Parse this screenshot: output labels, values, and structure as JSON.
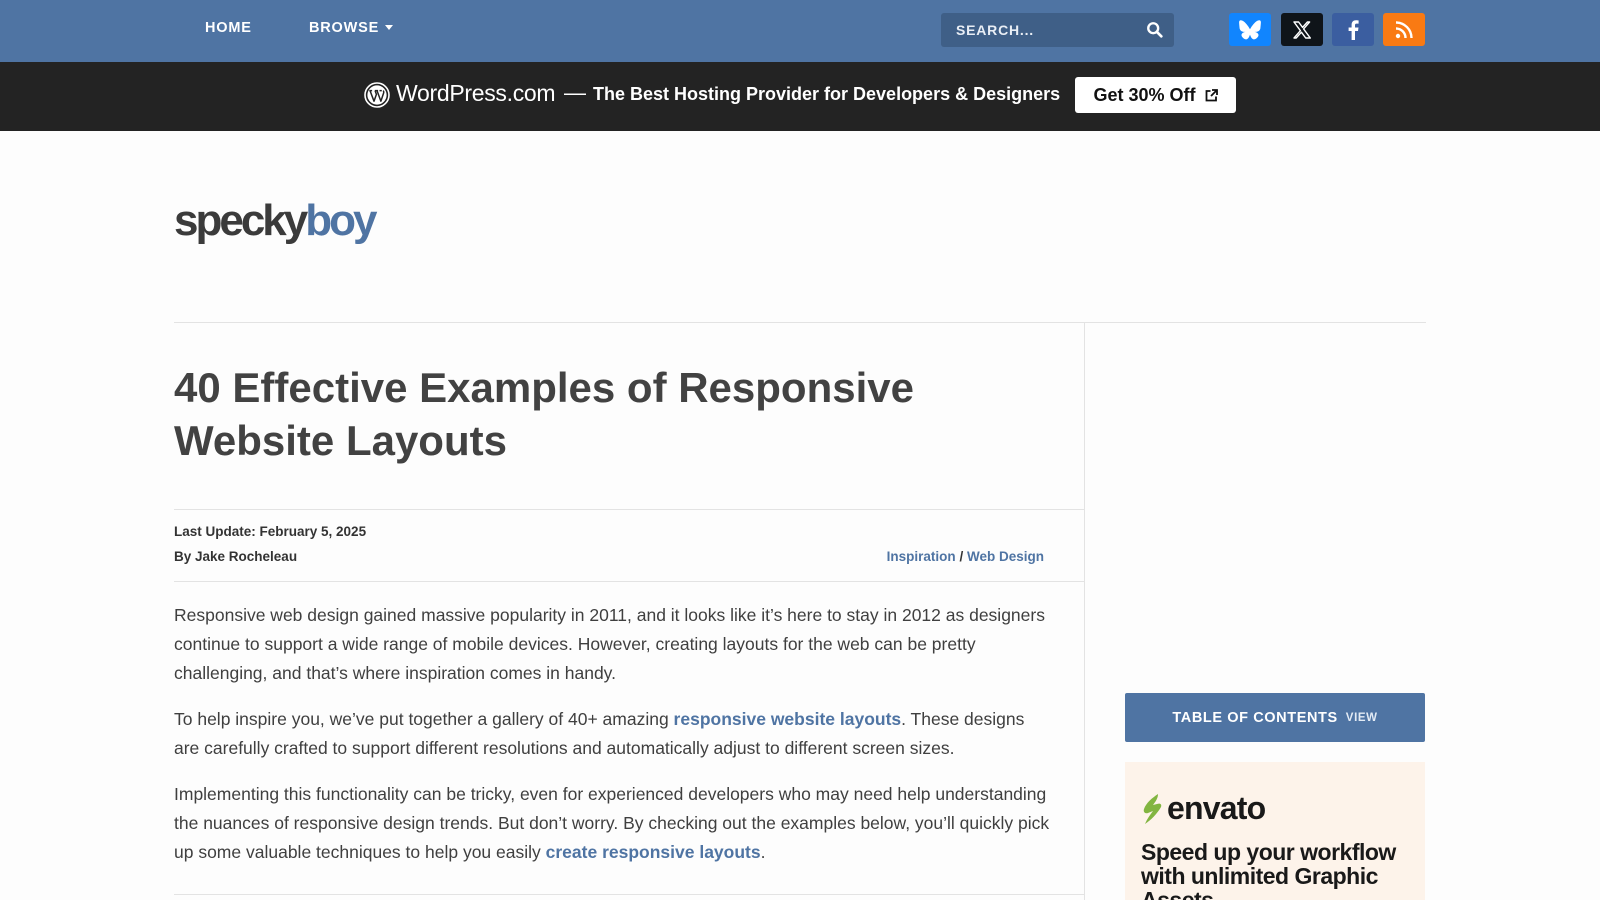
{
  "nav": {
    "home": "HOME",
    "browse": "BROWSE",
    "search_placeholder": "SEARCH..."
  },
  "social": [
    "bluesky-icon",
    "x-icon",
    "facebook-icon",
    "rss-icon"
  ],
  "promo": {
    "brand": "WordPress.com",
    "dash": "—",
    "tagline": "The Best Hosting Provider for Developers & Designers",
    "button": "Get 30% Off"
  },
  "site": {
    "logo_part1": "specky",
    "logo_part2": "boy"
  },
  "article": {
    "title": "40 Effective Examples of Responsive Website Layouts",
    "last_update": "Last Update: February 5, 2025",
    "byline": "By Jake Rocheleau",
    "category_1": "Inspiration",
    "category_sep": "/",
    "category_2": "Web Design",
    "p1": "Responsive web design gained massive popularity in 2011, and it looks like it’s here to stay in 2012 as designers continue to support a wide range of mobile devices. However, creating layouts for the web can be pretty challenging, and that’s where inspiration comes in handy.",
    "p2_a": "To help inspire you, we’ve put together a gallery of 40+ amazing ",
    "p2_link": "responsive website layouts",
    "p2_b": ". These designs are carefully crafted to support different resolutions and automatically adjust to different screen sizes.",
    "p3_a": "Implementing this functionality can be tricky, even for experienced developers who may need help understanding the nuances of responsive design trends. But don’t worry. By checking out the examples below, you’ll quickly pick up some valuable techniques to help you easily ",
    "p3_link": "create responsive layouts",
    "p3_b": "."
  },
  "sidebar": {
    "toc_label": "TABLE OF CONTENTS",
    "toc_view": "VIEW",
    "ad_brand": "envato",
    "ad_copy": "Speed up your workflow with unlimited Graphic Assets"
  },
  "colors": {
    "accent": "#4f74a3",
    "promo_bg": "#232323",
    "ad_bg": "#fdf3ea",
    "envato_green": "#82b541"
  }
}
